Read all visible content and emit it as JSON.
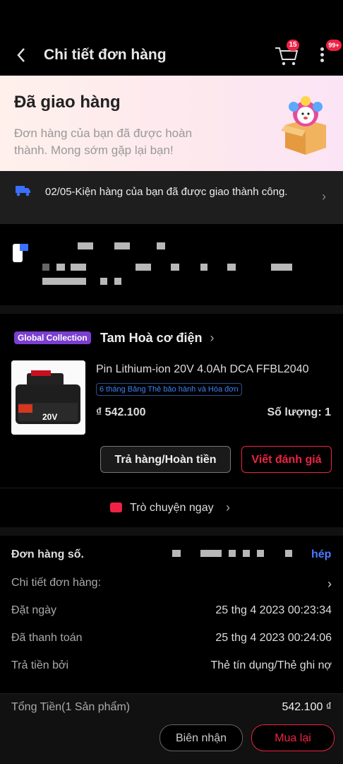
{
  "header": {
    "back_icon": "chevron-left-icon",
    "title": "Chi tiết đơn hàng",
    "cart_count": "15",
    "more_count": "99+"
  },
  "banner": {
    "title": "Đã giao hàng",
    "subtitle": "Đơn hàng của bạn đã được hoàn thành. Mong sớm gặp lại bạn!"
  },
  "delivery": {
    "text": "02/05-Kiện hàng của bạn đã được giao thành công."
  },
  "shop": {
    "badge": "Global Collection",
    "name": "Tam Hoà  cơ điện"
  },
  "product": {
    "name": "Pin Lithium-ion 20V 4.0Ah DCA FFBL2040",
    "warranty": "6 tháng Bảng Thẻ bảo hành và Hóa đơn",
    "price": "₫ 542.100",
    "quantity": "Số lượng: 1"
  },
  "actions": {
    "return": "Trả hàng/Hoàn tiền",
    "review": "Viết đánh giá",
    "chat": "Trò chuyện ngay"
  },
  "order": {
    "number_label": "Đơn hàng số.",
    "copy": "hép",
    "details_label": "Chi tiết đơn hàng:",
    "date_label": "Đặt ngày",
    "date_value": "25 thg 4 2023  00:23:34",
    "paid_label": "Đã thanh toán",
    "paid_value": "25 thg 4 2023  00:24:06",
    "pay_label": "Trả tiền bởi",
    "pay_value": "Thẻ tín dụng/Thẻ ghi nợ"
  },
  "total": {
    "label": "Tổng Tiền(1 Sản phẩm)",
    "value": "542.100 ₫"
  },
  "bottom": {
    "receipt": "Biên nhận",
    "rebuy": "Mua lại"
  },
  "colors": {
    "accent": "#ee2244",
    "link": "#4b7bff",
    "badge": "#7b3fd1"
  }
}
